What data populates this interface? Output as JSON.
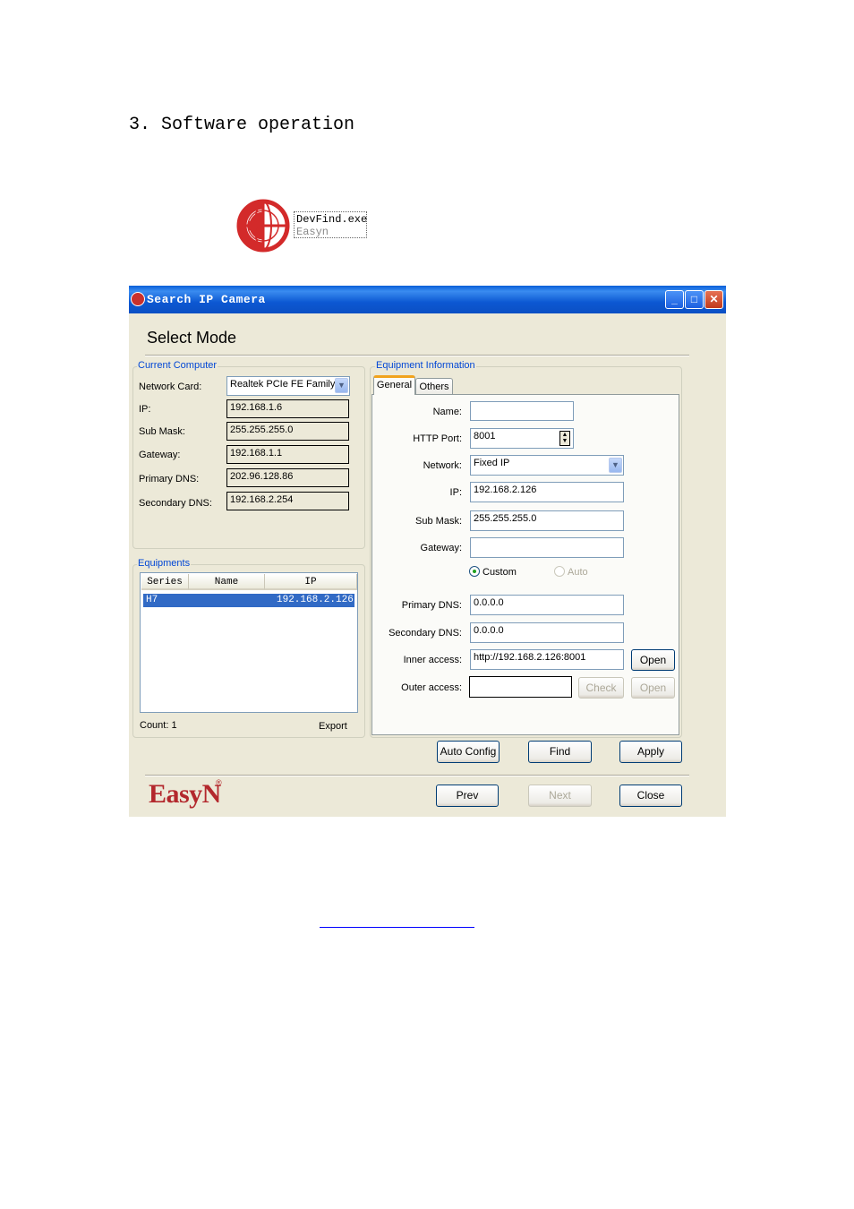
{
  "doc": {
    "heading": "3. Software operation"
  },
  "desktop_icon": {
    "name": "DevFind.exe",
    "subtitle": "Easyn"
  },
  "window": {
    "title": "Search IP Camera",
    "controls": {
      "minimize": "_",
      "maximize": "□",
      "close": "✕"
    },
    "page_title": "Select Mode",
    "current_computer": {
      "group_label": "Current Computer",
      "network_card_label": "Network Card:",
      "network_card_value": "Realtek PCIe FE Family C",
      "ip_label": "IP:",
      "ip_value": "192.168.1.6",
      "submask_label": "Sub Mask:",
      "submask_value": "255.255.255.0",
      "gateway_label": "Gateway:",
      "gateway_value": "192.168.1.1",
      "primary_dns_label": "Primary DNS:",
      "primary_dns_value": "202.96.128.86",
      "secondary_dns_label": "Secondary DNS:",
      "secondary_dns_value": "192.168.2.254"
    },
    "equipments": {
      "group_label": "Equipments",
      "columns": [
        "Series",
        "Name",
        "IP"
      ],
      "rows": [
        {
          "series": "H7",
          "name": "",
          "ip": "192.168.2.126"
        }
      ],
      "count_label": "Count: 1",
      "export_label": "Export"
    },
    "equipment_info": {
      "group_label": "Equipment Information",
      "tabs": [
        "General",
        "Others"
      ],
      "name_label": "Name:",
      "name_value": "",
      "http_port_label": "HTTP Port:",
      "http_port_value": "8001",
      "network_label": "Network:",
      "network_value": "Fixed IP",
      "ip_label": "IP:",
      "ip_value": "192.168.2.126",
      "submask_label": "Sub Mask:",
      "submask_value": "255.255.255.0",
      "gateway_label": "Gateway:",
      "gateway_value": "",
      "custom_label": "Custom",
      "auto_label": "Auto",
      "primary_dns_label": "Primary DNS:",
      "primary_dns_value": "0.0.0.0",
      "secondary_dns_label": "Secondary DNS:",
      "secondary_dns_value": "0.0.0.0",
      "inner_access_label": "Inner access:",
      "inner_access_value": "http://192.168.2.126:8001",
      "outer_access_label": "Outer access:",
      "outer_access_value": "",
      "open_label": "Open",
      "check_label": "Check",
      "open_disabled_label": "Open"
    },
    "actions": {
      "auto_config": "Auto Config",
      "find": "Find",
      "apply": "Apply"
    },
    "nav": {
      "prev": "Prev",
      "next": "Next",
      "close": "Close"
    },
    "brand": {
      "logo": "EasyN",
      "reg": "®"
    },
    "colors": {
      "titlebar": "#0a5fd8",
      "selection": "#316ac5",
      "brand": "#b3282d",
      "group_label": "#0046d5"
    }
  }
}
